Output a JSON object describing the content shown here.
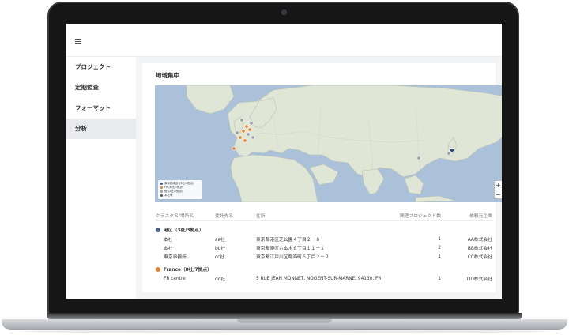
{
  "sidebar": {
    "items": [
      {
        "label": "プロジェクト"
      },
      {
        "label": "定期監査"
      },
      {
        "label": "フォーマット"
      },
      {
        "label": "分析"
      }
    ]
  },
  "main": {
    "title": "地域集中",
    "map": {
      "legend": [
        {
          "label": "東京都港区 (3社/3拠点)",
          "color": "#3b5998"
        },
        {
          "label": "FR (8社/7拠点)",
          "color": "#e8852c"
        },
        {
          "label": "他 (2社/2拠点)",
          "color": "#9aa0a8"
        },
        {
          "label": "本社等",
          "color": "#555555"
        }
      ],
      "zoom_in": "+",
      "zoom_out": "−"
    },
    "table": {
      "headers": [
        "クラスタ名/場所名",
        "委託先名",
        "住所",
        "関連プロジェクト数",
        "依頼元企業"
      ],
      "groups": [
        {
          "name": "港区（3社/3拠点）",
          "color": "#4a5f8f",
          "rows": [
            [
              "本社",
              "aa社",
              "東京都港区芝公園４丁目２－８",
              "1",
              "AA株式会社"
            ],
            [
              "本社",
              "bb社",
              "東京都港区六本木６丁目１１－１",
              "2",
              "BB株式会社"
            ],
            [
              "東京事務所",
              "cc社",
              "東京都江戸川区臨海町６丁目２－２",
              "1",
              "CC株式会社"
            ]
          ]
        },
        {
          "name": "France（8社/7拠点）",
          "color": "#e8852c",
          "rows": [
            [
              "FR centre",
              "dd社",
              "5 RUE JEAN MONNET, NOGENT-SUR-MARNE, 94130, FR",
              "1",
              "DD株式会社"
            ]
          ]
        }
      ]
    }
  }
}
